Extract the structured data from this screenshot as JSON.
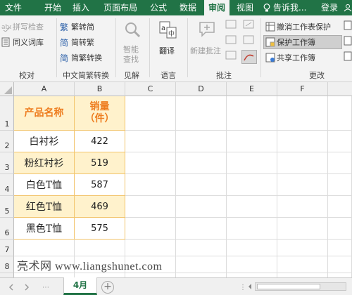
{
  "menu": [
    {
      "id": "file",
      "label": "文件"
    },
    {
      "id": "home",
      "label": "开始"
    },
    {
      "id": "insert",
      "label": "插入"
    },
    {
      "id": "layout",
      "label": "页面布局"
    },
    {
      "id": "formulas",
      "label": "公式"
    },
    {
      "id": "data",
      "label": "数据"
    },
    {
      "id": "review",
      "label": "审阅"
    },
    {
      "id": "view",
      "label": "视图"
    }
  ],
  "tell_me": "告诉我...",
  "login": "登录",
  "ribbon": {
    "spell_check": "拼写检查",
    "thesaurus": "同义词库",
    "proofing_group": "校对",
    "to_traditional": "繁转简",
    "to_simplified": "简转繁",
    "convert": "简繁转换",
    "chinese_group": "中文简繁转换",
    "smart_lookup_line1": "智能",
    "smart_lookup_line2": "查找",
    "insights_group": "见解",
    "translate": "翻译",
    "language_group": "语言",
    "new_comment": "新建批注",
    "comments_group": "批注",
    "unprotect_sheet": "撤消工作表保护",
    "protect_workbook": "保护工作簿",
    "share_workbook": "共享工作簿",
    "changes_group": "更改"
  },
  "columns": [
    "A",
    "B",
    "C",
    "D",
    "E",
    "F"
  ],
  "rows": [
    "1",
    "2",
    "3",
    "4",
    "5",
    "6",
    "7",
    "8"
  ],
  "table": {
    "header_a": "产品名称",
    "header_b_line1": "销量",
    "header_b_line2": "（件）",
    "rows": [
      {
        "name": "白衬衫",
        "qty": "422"
      },
      {
        "name": "粉红衬衫",
        "qty": "519"
      },
      {
        "name": "白色T恤",
        "qty": "587"
      },
      {
        "name": "红色T恤",
        "qty": "469"
      },
      {
        "name": "黑色T恤",
        "qty": "575"
      }
    ]
  },
  "watermark": "亮术网 www.liangshunet.com",
  "sheet_tab": "4月",
  "colors": {
    "ribbon_green": "#217346",
    "header_text": "#ee7d1f",
    "band_fill": "#fff2cc",
    "table_border": "#f2c46b"
  }
}
